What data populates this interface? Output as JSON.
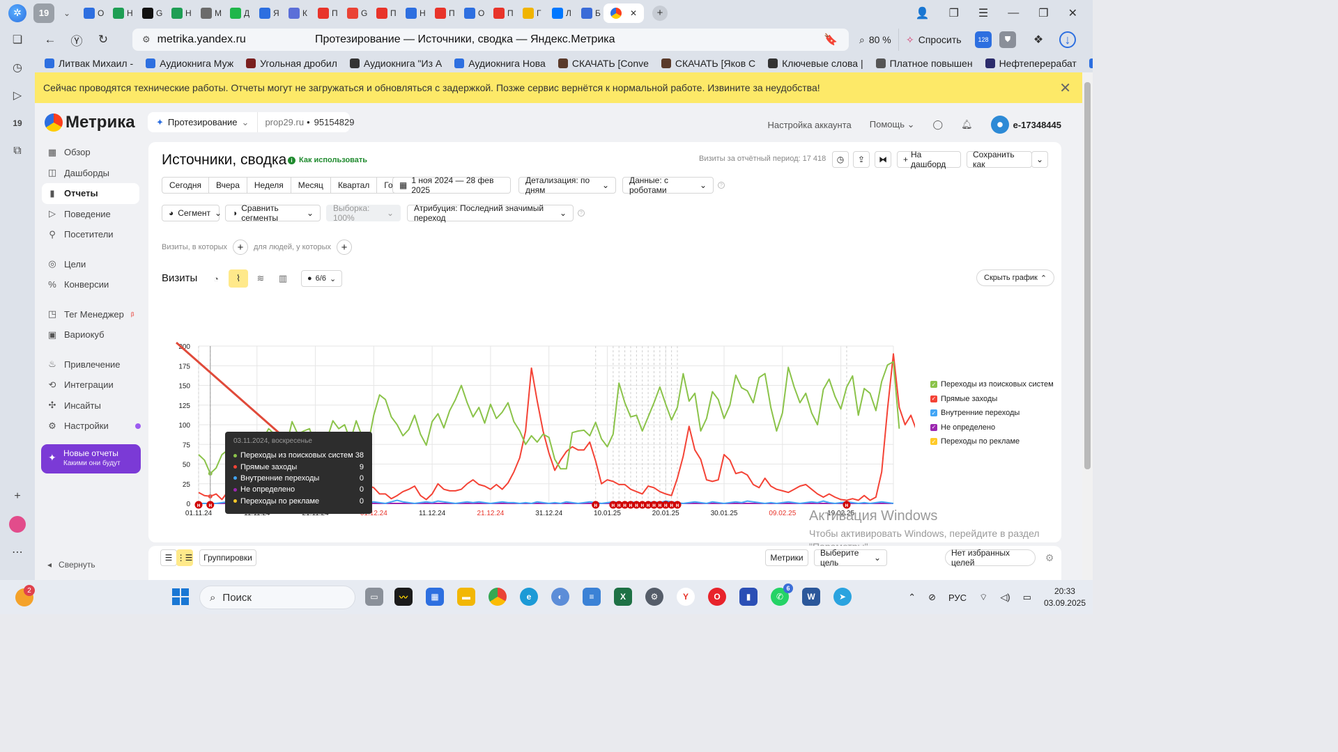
{
  "browser": {
    "tab_count": "19",
    "tabs": [
      {
        "label": "О",
        "color": "#2e6fe0"
      },
      {
        "label": "Н",
        "color": "#1e9e54"
      },
      {
        "label": "G",
        "color": "#111111"
      },
      {
        "label": "Н",
        "color": "#1e9e54"
      },
      {
        "label": "М",
        "color": "#6b6b6b"
      },
      {
        "label": "Д",
        "color": "#1fb64a"
      },
      {
        "label": "Я",
        "color": "#2d6fe0"
      },
      {
        "label": "К",
        "color": "#5b6fd8"
      },
      {
        "label": "П",
        "color": "#e8342a"
      },
      {
        "label": "G",
        "color": "#ea4335"
      },
      {
        "label": "П",
        "color": "#e8342a"
      },
      {
        "label": "Н",
        "color": "#2e6fe0"
      },
      {
        "label": "П",
        "color": "#e8342a"
      },
      {
        "label": "О",
        "color": "#2e6fe0"
      },
      {
        "label": "П",
        "color": "#e8342a"
      },
      {
        "label": "Г",
        "color": "#f0b400"
      },
      {
        "label": "Л",
        "color": "#0077ff"
      },
      {
        "label": "Б",
        "color": "#3a6bd8"
      }
    ],
    "address": "metrika.yandex.ru",
    "page_title": "Протезирование — Источники, сводка — Яндекс.Метрика",
    "zoom": "80 %",
    "ask_label": "Спросить",
    "ext_badge": "128",
    "bookmarks": [
      "Литвак Михаил - ",
      "Аудиокнига Муж",
      "Угольная дробил",
      "Аудиокнига \"Из А",
      "Аудиокнига Нова",
      "СКАЧАТЬ [Conve",
      "СКАЧАТЬ [Яков С",
      "Ключевые слова |",
      "Платное повышен",
      "Нефтеперерабат",
      "К"
    ]
  },
  "notice": "Сейчас проводятся технические работы. Отчеты могут не загружаться и обновляться с задержкой. Позже сервис вернётся к нормальной работе. Извините за неудобства!",
  "metrika": {
    "logo": "Метрика",
    "counter_name": "Протезирование",
    "counter_site": "prop29.ru",
    "counter_id": "95154829",
    "account_settings": "Настройка аккаунта",
    "help": "Помощь",
    "account": "e-17348445",
    "nav": [
      {
        "label": "Обзор",
        "icon": "▦"
      },
      {
        "label": "Дашборды",
        "icon": "◫"
      },
      {
        "label": "Отчеты",
        "icon": "▮"
      },
      {
        "label": "Поведение",
        "icon": "▷"
      },
      {
        "label": "Посетители",
        "icon": "⚲"
      },
      {
        "label": "Цели",
        "icon": "◎"
      },
      {
        "label": "Конверсии",
        "icon": "%"
      },
      {
        "label": "Тег Менеджер",
        "icon": "◳",
        "sup": "β"
      },
      {
        "label": "Вариокуб",
        "icon": "▣"
      },
      {
        "label": "Привлечение",
        "icon": "♨"
      },
      {
        "label": "Интеграции",
        "icon": "⟲"
      },
      {
        "label": "Инсайты",
        "icon": "✣"
      },
      {
        "label": "Настройки",
        "icon": "⚙"
      }
    ],
    "new_reports_title": "Новые отчеты",
    "new_reports_sub": "Какими они будут",
    "collapse": "Свернуть"
  },
  "report": {
    "title": "Источники, сводка",
    "how_to": "Как использовать",
    "visits_total": "Визиты за отчётный период: 17 418",
    "to_dashboard": "На дашборд",
    "save_as": "Сохранить как",
    "periods": [
      "Сегодня",
      "Вчера",
      "Неделя",
      "Месяц",
      "Квартал",
      "Год"
    ],
    "date_range": "1 ноя 2024 — 28 фев 2025",
    "detail": "Детализация: по дням",
    "data": "Данные: с роботами",
    "segment": "Сегмент",
    "compare": "Сравнить сегменты",
    "sample": "Выборка: 100%",
    "attribution": "Атрибуция: Последний значимый переход",
    "filter_visits": "Визиты, в которых",
    "filter_people": "для людей, у которых",
    "graph_title": "Визиты",
    "comments": "6/6",
    "hide_graph": "Скрыть график",
    "groupings": "Группировки",
    "metrics": "Метрики",
    "choose_goal": "Выберите цель",
    "fav_goals": "Нет избранных целей"
  },
  "tooltip": {
    "date": "03.11.2024, воскресенье",
    "rows": [
      {
        "name": "Переходы из поисковых систем",
        "value": "38",
        "color": "#8bc34a"
      },
      {
        "name": "Прямые заходы",
        "value": "9",
        "color": "#f44336"
      },
      {
        "name": "Внутренние переходы",
        "value": "0",
        "color": "#42a5f5"
      },
      {
        "name": "Не определено",
        "value": "0",
        "color": "#9c27b0"
      },
      {
        "name": "Переходы по рекламе",
        "value": "0",
        "color": "#ffca28"
      }
    ]
  },
  "chart_data": {
    "type": "line",
    "title": "",
    "xlabel": "",
    "ylabel": "",
    "ylim": [
      0,
      200
    ],
    "yticks": [
      0,
      25,
      50,
      75,
      100,
      125,
      150,
      175,
      200
    ],
    "xtick_labels": [
      "01.11.24",
      "11.11.24",
      "21.11.24",
      "01.12.24",
      "11.12.24",
      "21.12.24",
      "31.12.24",
      "10.01.25",
      "20.01.25",
      "30.01.25",
      "09.02.25",
      "19.02.25"
    ],
    "xtick_red": [
      false,
      false,
      false,
      true,
      false,
      true,
      false,
      false,
      false,
      false,
      true,
      false
    ],
    "x_start": "2024-11-01",
    "x_end": "2025-02-28",
    "grid": true,
    "legend_position": "right",
    "series": [
      {
        "name": "Переходы из поисковых систем",
        "color": "#8bc34a",
        "values": [
          62,
          55,
          38,
          45,
          62,
          68,
          75,
          70,
          78,
          82,
          75,
          82,
          95,
          88,
          78,
          72,
          104,
          88,
          92,
          95,
          73,
          68,
          82,
          105,
          95,
          100,
          80,
          105,
          85,
          74,
          112,
          138,
          132,
          110,
          100,
          86,
          94,
          112,
          88,
          74,
          104,
          114,
          96,
          118,
          132,
          150,
          128,
          110,
          122,
          102,
          126,
          108,
          116,
          128,
          104,
          92,
          75,
          86,
          78,
          88,
          84,
          56,
          44,
          44,
          90,
          92,
          93,
          86,
          103,
          82,
          72,
          88,
          153,
          128,
          110,
          112,
          92,
          110,
          128,
          148,
          126,
          106,
          122,
          165,
          130,
          140,
          92,
          108,
          142,
          132,
          108,
          125,
          163,
          147,
          143,
          128,
          160,
          165,
          122,
          92,
          115,
          173,
          148,
          128,
          140,
          115,
          100,
          145,
          158,
          136,
          120,
          148,
          162,
          112,
          146,
          140,
          118,
          155,
          176,
          180,
          95
        ]
      },
      {
        "name": "Прямые заходы",
        "color": "#f44336",
        "values": [
          14,
          10,
          9,
          12,
          5,
          15,
          8,
          84,
          27,
          35,
          48,
          25,
          30,
          34,
          28,
          30,
          18,
          26,
          15,
          20,
          16,
          18,
          17,
          14,
          23,
          32,
          18,
          15,
          12,
          23,
          20,
          12,
          12,
          6,
          10,
          15,
          18,
          22,
          10,
          5,
          12,
          25,
          18,
          16,
          16,
          18,
          25,
          30,
          24,
          22,
          18,
          24,
          18,
          26,
          40,
          58,
          92,
          172,
          130,
          92,
          64,
          42,
          55,
          66,
          72,
          68,
          68,
          78,
          54,
          25,
          30,
          28,
          24,
          24,
          18,
          15,
          12,
          22,
          20,
          15,
          12,
          10,
          32,
          60,
          98,
          68,
          56,
          30,
          28,
          30,
          62,
          55,
          38,
          40,
          36,
          24,
          20,
          32,
          22,
          18,
          16,
          14,
          18,
          22,
          24,
          18,
          12,
          8,
          12,
          8,
          5,
          4,
          6,
          4,
          10,
          4,
          8,
          40,
          120,
          190,
          122,
          100,
          112,
          92,
          98,
          132
        ]
      },
      {
        "name": "Внутренние переходы",
        "color": "#42a5f5",
        "values": [
          0,
          0,
          0,
          0,
          1,
          2,
          0,
          1,
          0,
          1,
          0,
          2,
          1,
          0,
          0,
          1,
          2,
          3,
          1,
          0,
          1,
          2,
          1,
          0,
          1,
          2,
          3,
          2,
          1,
          1,
          2,
          1,
          0,
          2,
          4,
          2,
          1,
          0,
          1,
          2,
          1,
          3,
          2,
          1,
          0,
          1,
          2,
          1,
          2,
          1,
          0,
          1,
          2,
          1,
          1,
          0,
          1,
          0,
          2,
          1,
          0,
          1,
          0,
          2,
          1,
          0,
          1,
          2,
          1,
          0,
          1,
          2,
          1,
          0,
          2,
          1,
          0,
          1,
          2,
          1,
          3,
          2,
          1,
          0,
          1,
          2,
          1,
          0,
          2,
          1,
          0,
          1,
          2,
          1,
          3,
          2,
          1,
          0,
          1,
          0,
          1,
          2,
          1,
          0,
          1,
          2,
          1,
          3,
          1,
          0,
          1,
          2,
          1,
          0,
          1,
          0,
          1,
          2,
          1,
          0
        ]
      },
      {
        "name": "Не определено",
        "color": "#9c27b0",
        "values": [
          0,
          0,
          0,
          0,
          0,
          0,
          0,
          0,
          0,
          0,
          0,
          0,
          0,
          0,
          0,
          0,
          0,
          0,
          0,
          0,
          0,
          0,
          0,
          0,
          0,
          0,
          0,
          0,
          0,
          0,
          0,
          0,
          0,
          0,
          0,
          0,
          0,
          0,
          0,
          0,
          0,
          0,
          0,
          0,
          0,
          0,
          0,
          0,
          0,
          0,
          0,
          0,
          0,
          0,
          0,
          0,
          0,
          0,
          0,
          0,
          0,
          0,
          0,
          0,
          0,
          0,
          0,
          0,
          0,
          0,
          0,
          0,
          0,
          0,
          0,
          0,
          0,
          0,
          0,
          0,
          0,
          0,
          0,
          0,
          0,
          0,
          0,
          0,
          0,
          0,
          0,
          0,
          0,
          0,
          0,
          0,
          0,
          0,
          0,
          0,
          0,
          0,
          0,
          0,
          0,
          0,
          0,
          0,
          0,
          0,
          0,
          0,
          0,
          0,
          0,
          0,
          0,
          0,
          0,
          0
        ]
      },
      {
        "name": "Переходы по рекламе",
        "color": "#ffca28",
        "values": [
          0,
          0,
          0,
          0,
          0,
          0,
          0,
          0,
          0,
          0,
          0,
          0,
          0,
          0,
          0,
          0,
          0,
          0,
          0,
          0,
          0,
          0,
          0,
          0,
          0,
          0,
          0,
          0,
          0,
          0,
          0,
          0,
          0,
          0,
          0,
          0,
          0,
          0,
          0,
          0,
          0,
          0,
          0,
          0,
          0,
          0,
          0,
          0,
          0,
          0,
          0,
          0,
          0,
          0,
          0,
          0,
          0,
          0,
          0,
          0,
          0,
          0,
          0,
          0,
          0,
          0,
          0,
          0,
          0,
          0,
          0,
          0,
          0,
          0,
          0,
          0,
          0,
          0,
          0,
          0,
          0,
          0,
          0,
          0,
          0,
          0,
          0,
          0,
          0,
          0,
          0,
          0,
          0,
          0,
          0,
          0,
          0,
          0,
          0,
          0,
          0,
          0,
          0,
          0,
          0,
          0,
          0,
          0,
          0,
          0,
          0,
          0,
          0,
          0,
          0,
          0,
          0,
          0,
          0,
          0
        ]
      }
    ],
    "annotation_marker": "н",
    "annotation_days": [
      0,
      2,
      68,
      71,
      72,
      73,
      74,
      75,
      76,
      77,
      78,
      79,
      80,
      81,
      82,
      111
    ]
  },
  "windows": {
    "activation_title": "Активация Windows",
    "activation_text_1": "Чтобы активировать Windows, перейдите в раздел",
    "activation_text_2": "\"Параметры\"."
  },
  "taskbar": {
    "weather_badge": "2",
    "search": "Поиск",
    "lang": "РУС",
    "time": "20:33",
    "date": "03.09.2025",
    "whatsapp_badge": "6"
  }
}
